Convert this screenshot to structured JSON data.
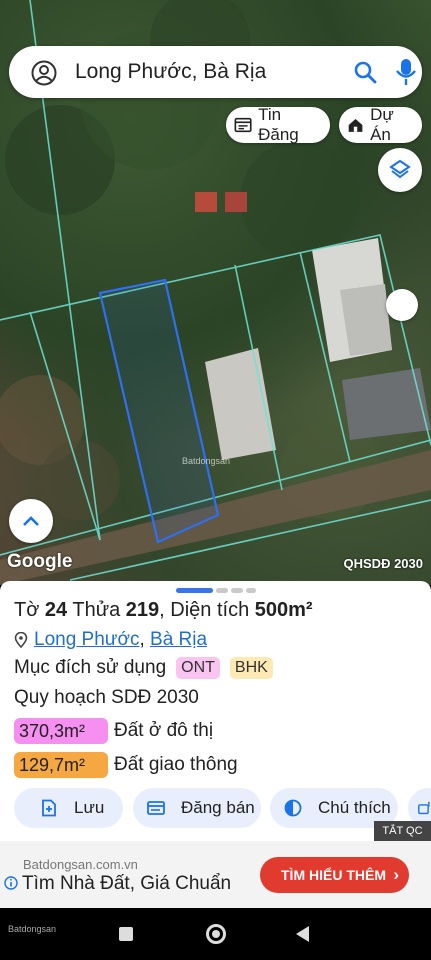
{
  "search": {
    "query": "Long Phước, Bà Rịa"
  },
  "map_buttons": {
    "tin_dang": "Tin Đăng",
    "du_an": "Dự Án"
  },
  "map": {
    "google": "Google",
    "layer_label": "QHSDĐ 2030",
    "watermark": "Batdongsan"
  },
  "parcel": {
    "to_label": "Tờ",
    "to": "24",
    "thua_label": "Thửa",
    "thua": "219",
    "dientich_label": ", Diện tích",
    "dientich": "500m²",
    "location_ward": "Long Phước",
    "location_sep": ",",
    "location_city": "Bà Rịa",
    "purpose_label": "Mục đích sử dụng",
    "tags": [
      "ONT",
      "BHK"
    ],
    "plan_label": "Quy hoạch SDĐ 2030",
    "areas": [
      {
        "value": "370,3m²",
        "label": "Đất ở đô thị",
        "color": "#f58ff0"
      },
      {
        "value": "129,7m²",
        "label": "Đất giao thông",
        "color": "#f5a742"
      }
    ]
  },
  "actions": {
    "save": "Lưu",
    "post": "Đăng bán",
    "note": "Chú thích"
  },
  "ad": {
    "close_label": "TẮT QC",
    "domain": "Batdongsan.com.vn",
    "headline": "Tìm Nhà Đất, Giá Chuẩn",
    "cta": "TÌM HIỂU THÊM",
    "brand": "Batdongsan"
  },
  "colors": {
    "accent": "#1f6fd1",
    "cta": "#e13b30"
  }
}
